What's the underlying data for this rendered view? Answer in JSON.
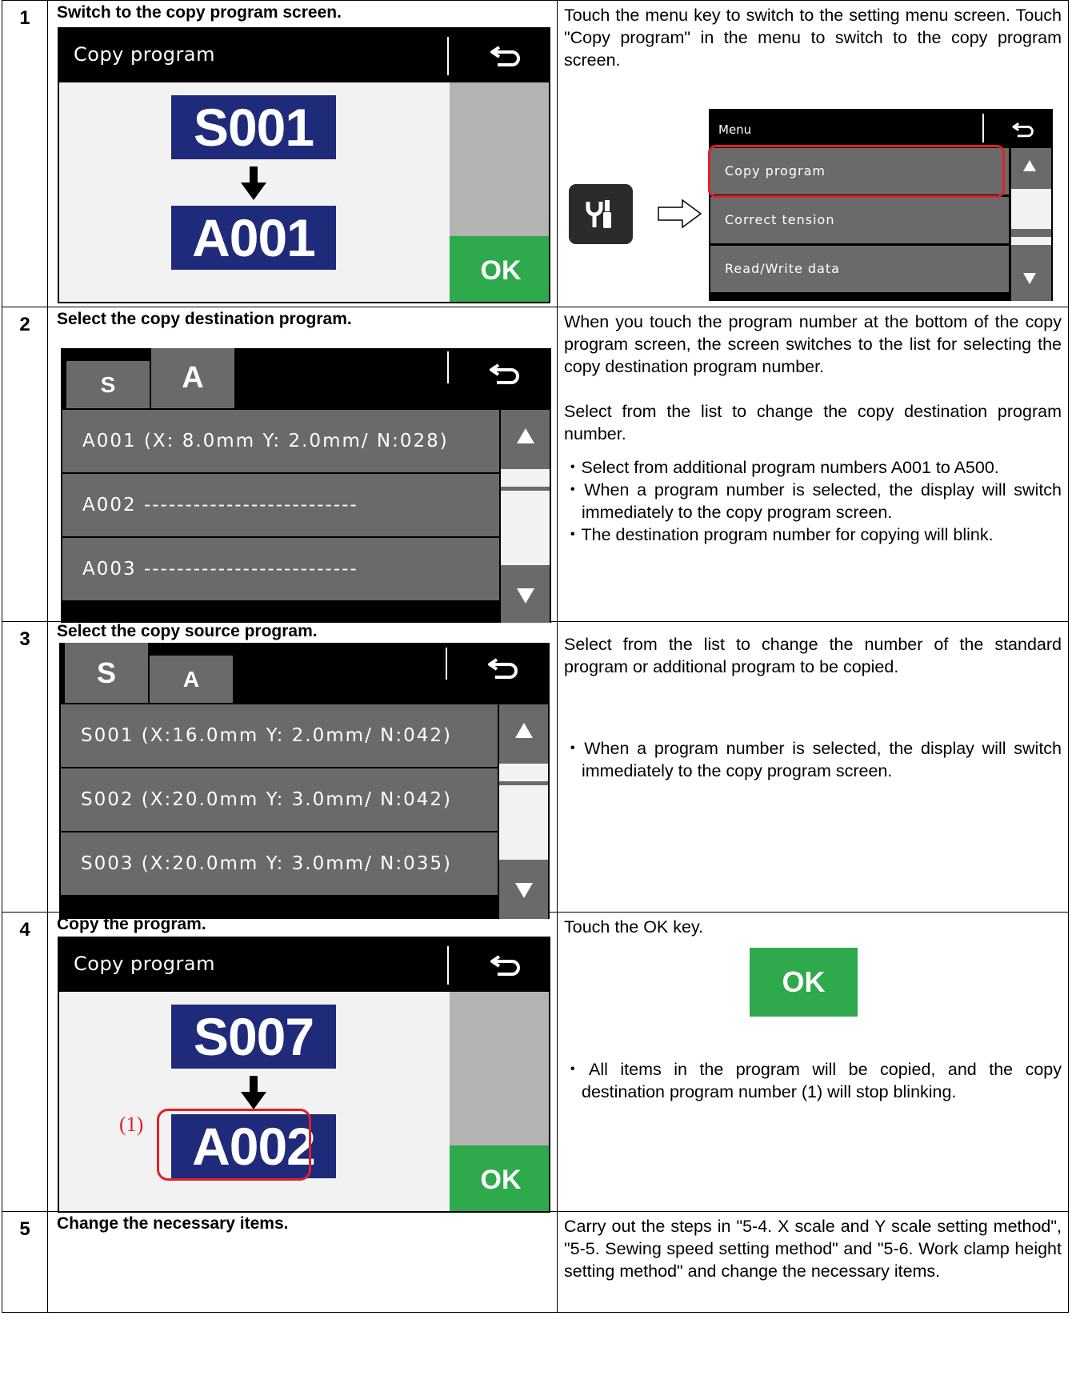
{
  "steps": [
    {
      "num": "1",
      "title": "Switch to the copy program screen.",
      "screen": {
        "title": "Copy program",
        "source": "S001",
        "dest": "A001",
        "ok": "OK"
      },
      "desc": [
        "Touch the menu key to switch to the setting menu screen. Touch \"Copy program\" in the menu to switch to the copy program screen."
      ],
      "menu": {
        "title": "Menu",
        "items": [
          "Copy program",
          "Correct tension",
          "Read/Write data"
        ]
      }
    },
    {
      "num": "2",
      "title": "Select the copy destination program.",
      "tabs": [
        "S",
        "A"
      ],
      "rows": [
        "A001 (X:  8.0mm Y:  2.0mm/ N:028)",
        "A002 --------------------------",
        "A003 --------------------------"
      ],
      "desc": [
        "When you touch the program number at the bottom of the copy program screen, the screen switches to the list for selecting the copy destination program number.",
        "Select from the list to change the copy destination program number."
      ],
      "bullets": [
        "・Select from additional program numbers A001 to A500.",
        "・When a program number is selected, the display will switch immediately to the copy program screen.",
        "・The destination program number for copying will blink."
      ]
    },
    {
      "num": "3",
      "title": "Select the copy source program.",
      "tabs": [
        "S",
        "A"
      ],
      "rows": [
        "S001 (X:16.0mm Y:  2.0mm/ N:042)",
        "S002 (X:20.0mm Y:  3.0mm/ N:042)",
        "S003 (X:20.0mm Y:  3.0mm/ N:035)"
      ],
      "desc": [
        "Select from the list to change the number of the standard program or additional program to be copied."
      ],
      "bullets": [
        "・When a program number is selected, the display will switch immediately to the copy program screen."
      ]
    },
    {
      "num": "4",
      "title": "Copy the program.",
      "screen": {
        "title": "Copy program",
        "source": "S007",
        "dest": "A002",
        "ok": "OK",
        "callout": "(1)"
      },
      "desc": [
        "Touch the OK key."
      ],
      "ok_key": "OK",
      "bullets": [
        "・All items in the program will be copied, and the copy destination program number (1) will stop blinking."
      ]
    },
    {
      "num": "5",
      "title": "Change the necessary items.",
      "desc": [
        "Carry out the steps in \"5-4. X scale and Y scale setting method\", \"5-5. Sewing speed setting method\" and \"5-6. Work clamp height setting method\" and change the necessary items."
      ]
    }
  ],
  "colors": {
    "program_box": "#1f2a7a",
    "ok_green": "#2eaa4c",
    "highlight_red": "#e0202a",
    "list_gray": "#6a6a6a"
  },
  "icons": [
    "back-arrow-icon",
    "arrow-down-icon",
    "menu-key-tool-icon",
    "hollow-arrow-right-icon",
    "scroll-up-icon",
    "scroll-down-icon"
  ]
}
